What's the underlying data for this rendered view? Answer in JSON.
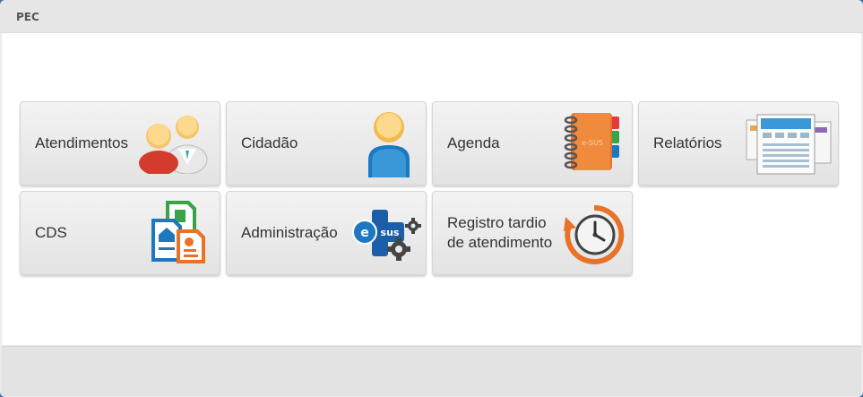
{
  "window": {
    "title": "PEC"
  },
  "tiles": [
    {
      "label": "Atendimentos",
      "icon": "users-icon"
    },
    {
      "label": "Cidadão",
      "icon": "user-icon"
    },
    {
      "label": "Agenda",
      "icon": "agenda-book-icon",
      "icon_text": "e-SUS"
    },
    {
      "label": "Relatórios",
      "icon": "reports-icon"
    },
    {
      "label": "CDS",
      "icon": "cds-forms-icon"
    },
    {
      "label": "Administração",
      "icon": "esus-gears-icon",
      "icon_text": "sus"
    },
    {
      "label": "Registro tardio\nde atendimento",
      "icon": "clock-history-icon"
    }
  ],
  "colors": {
    "accent_blue": "#1c78c0",
    "accent_orange": "#e8722a",
    "accent_red": "#d33b2c",
    "accent_green": "#3aa34a"
  }
}
